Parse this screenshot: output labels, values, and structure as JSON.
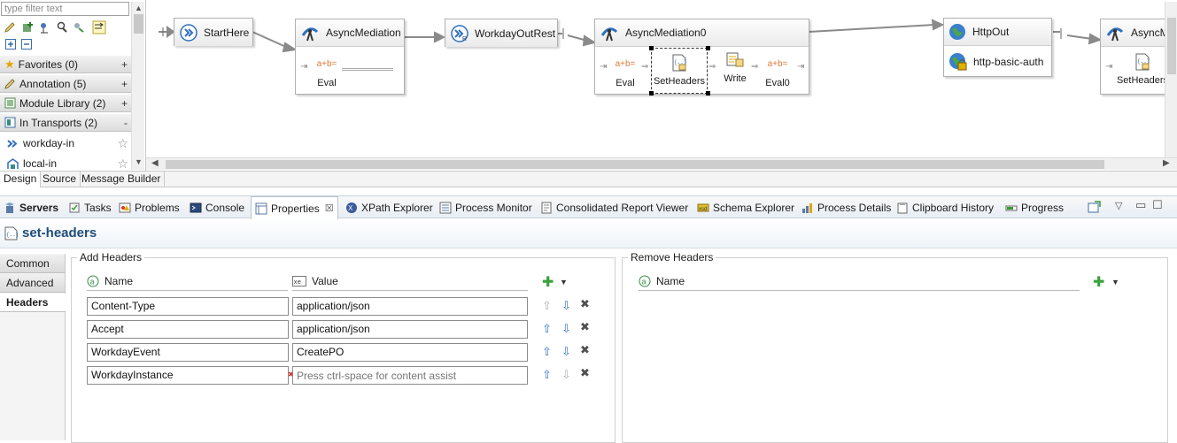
{
  "palette": {
    "filter_placeholder": "type filter text",
    "categories": [
      {
        "label": "Favorites (0)",
        "toggle": "+"
      },
      {
        "label": "Annotation (5)",
        "toggle": "+"
      },
      {
        "label": "Module Library (2)",
        "toggle": "+"
      },
      {
        "label": "In Transports (2)",
        "toggle": "-"
      }
    ],
    "items": [
      {
        "label": "workday-in",
        "star": "☆"
      },
      {
        "label": "local-in",
        "star": "☆"
      }
    ]
  },
  "canvas": {
    "nodes": {
      "start": {
        "title": "StartHere"
      },
      "async1": {
        "title": "AsyncMediation",
        "steps": [
          "Eval"
        ]
      },
      "workday": {
        "title": "WorkdayOutRest"
      },
      "async0": {
        "title": "AsyncMediation0",
        "steps": [
          "Eval",
          "SetHeaders",
          "Write",
          "Eval0"
        ]
      },
      "httpout": {
        "title": "HttpOut",
        "sub": "http-basic-auth"
      },
      "async2": {
        "title": "AsyncMed",
        "steps": [
          "SetHeaders"
        ]
      }
    }
  },
  "editor_tabs": [
    "Design",
    "Source",
    "Message Builder"
  ],
  "view_tabs": [
    {
      "label": "Servers",
      "bold": true
    },
    {
      "label": "Tasks"
    },
    {
      "label": "Problems"
    },
    {
      "label": "Console"
    },
    {
      "label": "Properties",
      "close": "☒"
    },
    {
      "label": "XPath Explorer"
    },
    {
      "label": "Process Monitor"
    },
    {
      "label": "Consolidated Report Viewer"
    },
    {
      "label": "Schema Explorer"
    },
    {
      "label": "Process Details"
    },
    {
      "label": "Clipboard History"
    },
    {
      "label": "Progress"
    }
  ],
  "properties": {
    "title": "set-headers",
    "side_tabs": [
      "Common",
      "Advanced",
      "Headers"
    ],
    "add_headers": {
      "group_label": "Add Headers",
      "col_name": "Name",
      "col_value": "Value",
      "rows": [
        {
          "name": "Content-Type",
          "value": "application/json"
        },
        {
          "name": "Accept",
          "value": "application/json"
        },
        {
          "name": "WorkdayEvent",
          "value": "CreatePO"
        },
        {
          "name": "WorkdayInstance",
          "value": ""
        }
      ],
      "value_placeholder": "Press ctrl-space for content assist"
    },
    "remove_headers": {
      "group_label": "Remove Headers",
      "col_name": "Name"
    }
  },
  "colors": {
    "accent": "#1f4e79",
    "add_green": "#3aa23a",
    "arrow_blue": "#2f6fc1",
    "error_red": "#d9322b"
  }
}
